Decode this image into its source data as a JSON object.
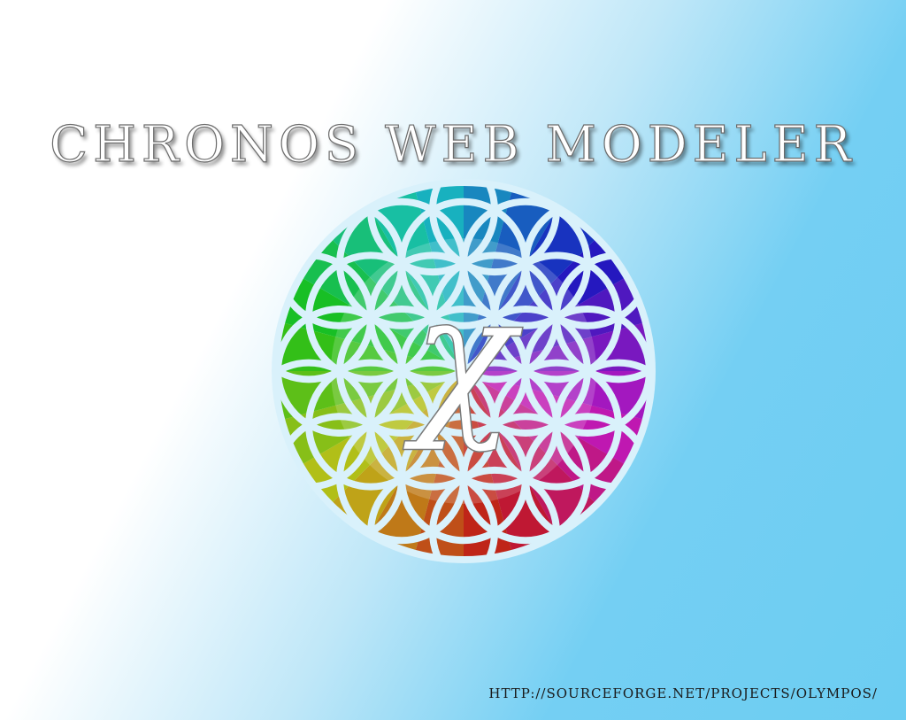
{
  "title": "CHRONOS WEB MODELER",
  "logo": {
    "symbol": "χ",
    "icon": "flower-of-life-icon"
  },
  "footer": {
    "url": "HTTP://SOURCEFORGE.NET/PROJECTS/OLYMPOS/"
  },
  "colors": {
    "background_light": "#ffffff",
    "background_blue": "#6ccdf2",
    "logo_lines": "#d9f1fb",
    "palette": [
      "#0a9fd6",
      "#4a63a8",
      "#7a2f8f",
      "#c21878",
      "#e0245c",
      "#c0563c",
      "#d8a21a",
      "#b7c524",
      "#5aa84a",
      "#1a9a8a"
    ]
  }
}
